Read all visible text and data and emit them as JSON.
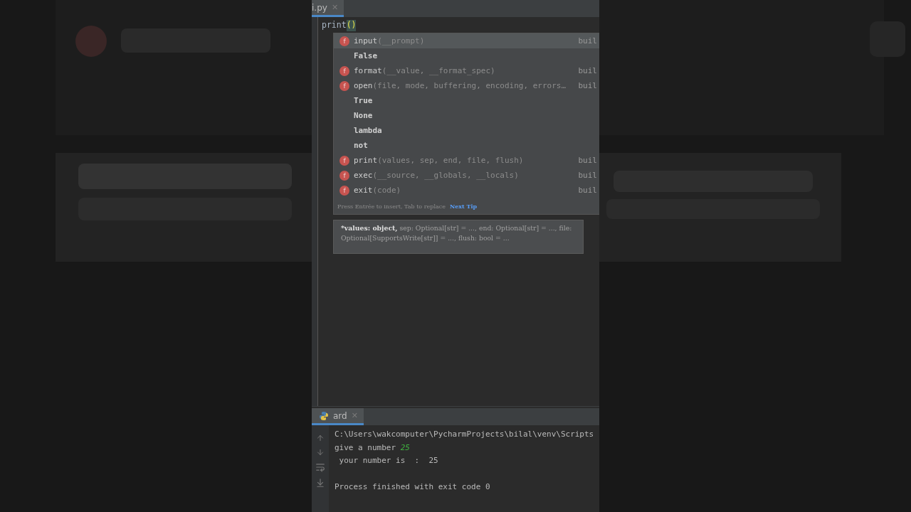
{
  "editor_tab": {
    "label": "i.py",
    "close": "✕",
    "selected": true
  },
  "code_line": {
    "name": "print",
    "brackets": "()"
  },
  "completion": {
    "items": [
      {
        "kind": "function",
        "icon": "f",
        "name": "input",
        "params": "(__prompt)",
        "type": "buil",
        "selected": true
      },
      {
        "kind": "keyword",
        "name": "False",
        "selected": false
      },
      {
        "kind": "function",
        "icon": "f",
        "name": "format",
        "params": "(__value, __format_spec)",
        "type": "buil",
        "selected": false
      },
      {
        "kind": "function",
        "icon": "f",
        "name": "open",
        "params": "(file, mode, buffering, encoding, errors…",
        "type": "buil",
        "selected": false
      },
      {
        "kind": "keyword",
        "name": "True",
        "selected": false
      },
      {
        "kind": "keyword",
        "name": "None",
        "selected": false
      },
      {
        "kind": "keyword",
        "name": "lambda",
        "selected": false
      },
      {
        "kind": "keyword",
        "name": "not",
        "selected": false
      },
      {
        "kind": "function",
        "icon": "f",
        "name": "print",
        "params": "(values, sep, end, file, flush)",
        "type": "buil",
        "selected": false
      },
      {
        "kind": "function",
        "icon": "f",
        "name": "exec",
        "params": "(__source, __globals, __locals)",
        "type": "buil",
        "selected": false
      },
      {
        "kind": "function",
        "icon": "f",
        "name": "exit",
        "params": "(code)",
        "type": "buil",
        "selected": false
      }
    ],
    "hint": "Press Entrée to insert, Tab to replace",
    "tip_link": "Next Tip"
  },
  "parameter_info": {
    "bold": "*values: object,",
    "rest": "sep: Optional[str] = ..., end: Optional[str] = ..., file: Optional[SupportsWrite[str]] = ..., flush: bool = ..."
  },
  "run_tab": {
    "label": "ard",
    "close": "✕",
    "selected": true
  },
  "console": [
    {
      "kind": "output",
      "text": "C:\\Users\\wakcomputer\\PycharmProjects\\bilal\\venv\\Scripts"
    },
    {
      "kind": "output",
      "text": "give a number ",
      "input": "25"
    },
    {
      "kind": "output",
      "text": " your number is  :  25"
    },
    {
      "kind": "status",
      "text": "Process finished with exit code 0"
    }
  ]
}
